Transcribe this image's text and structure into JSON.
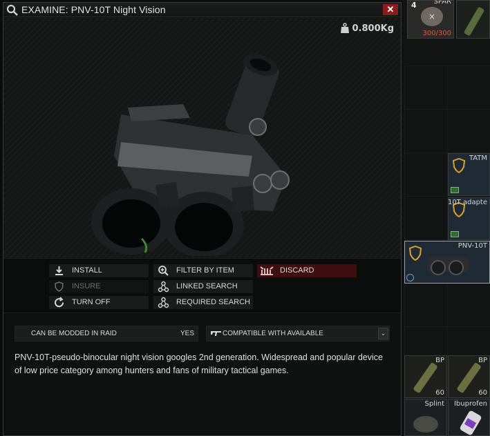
{
  "window": {
    "title": "EXAMINE: PNV-10T Night Vision",
    "close_label": "✕"
  },
  "item": {
    "weight": "0.800Kg",
    "description": "PNV-10T-pseudo-binocular night vision googles 2nd generation. Widespread and popular device of low price category among hunters and fans of military tactical games."
  },
  "actions": {
    "install": "INSTALL",
    "insure": "INSURE",
    "turn_off": "TURN OFF",
    "filter_by_item": "FILTER BY ITEM",
    "linked_search": "LINKED SEARCH",
    "required_search": "REQUIRED SEARCH",
    "discard": "DISCARD"
  },
  "properties": {
    "mod_label": "CAN BE MODDED IN RAID",
    "mod_value": "YES",
    "compatibility_dropdown": "COMPATIBLE WITH AVAILABLE"
  },
  "inventory": {
    "top_slot_count": "4",
    "top_slot_durability": "300/300",
    "top_slot_label": "SPAR",
    "tatm_label": "TATM",
    "adapter_label": "10T adapte",
    "pnv_label": "PNV-10T",
    "bp_label_1": "BP",
    "bp_count_1": "60",
    "bp_label_2": "BP",
    "bp_count_2": "60",
    "splint_label": "Splint",
    "ibuprofen_label": "Ibuprofen"
  },
  "colors": {
    "accent_danger": "#3f0f0f",
    "close_red": "#8b1d1d",
    "durability_red": "#e05a3a",
    "highlight_blue": "#2a4a7a"
  }
}
